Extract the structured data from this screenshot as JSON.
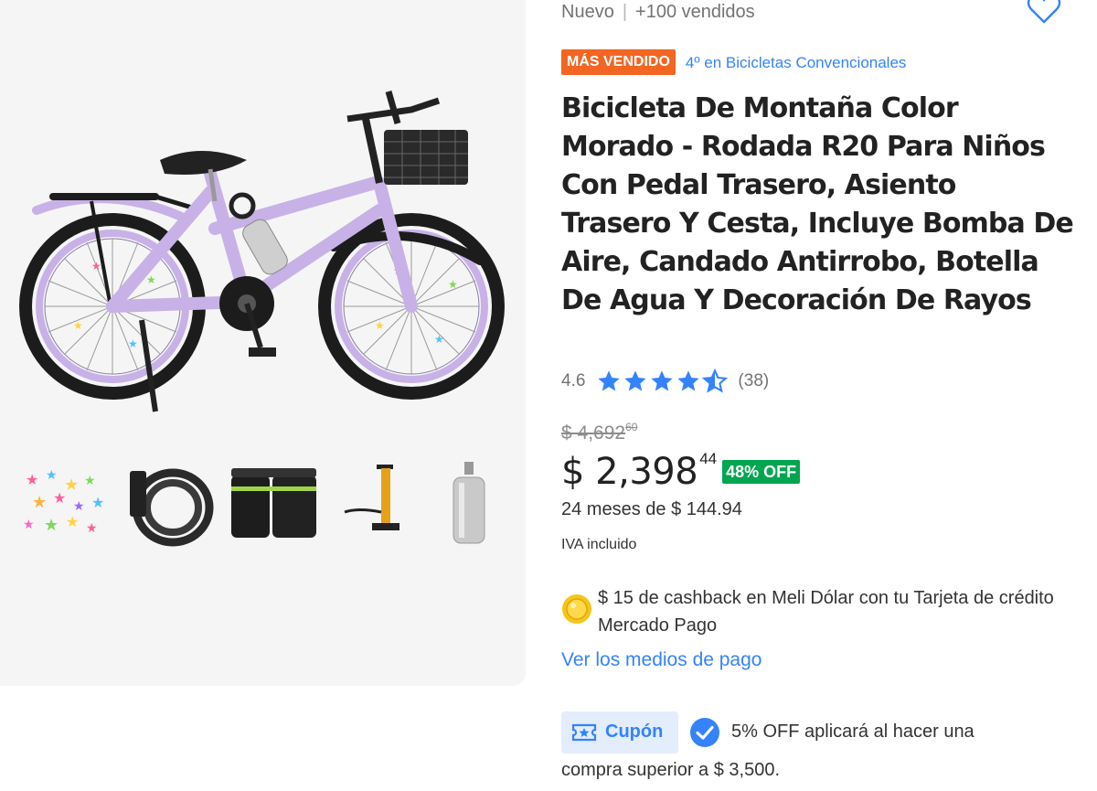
{
  "product": {
    "condition": "Nuevo",
    "separator": "|",
    "sold": "+100 vendidos",
    "badge": "MÁS VENDIDO",
    "category_rank": "4º en Bicicletas Convencionales",
    "title": "Bicicleta De Montaña Color Morado - Rodada R20 Para Niños Con Pedal Trasero, Asiento Trasero Y Cesta, Incluye Bomba De Aire, Candado Antirrobo, Botella De Agua Y Decoración De Rayos",
    "rating": "4.6",
    "rating_value": 4.6,
    "rating_count": "(38)"
  },
  "pricing": {
    "old_price": "$ 4,692",
    "old_price_cents": "60",
    "price": "$ 2,398",
    "price_cents": "44",
    "discount": "48% OFF",
    "installments": "24 meses de $ 144.94",
    "tax_note": "IVA incluido"
  },
  "cashback": {
    "text": "$ 15 de cashback en Meli Dólar con tu Tarjeta de crédito Mercado Pago"
  },
  "payment_link": "Ver los medios de pago",
  "coupon": {
    "label": "Cupón",
    "line1": "5% OFF aplicará al hacer una",
    "line2": "compra superior a $ 3,500."
  },
  "gallery": {
    "main_image": "purple-kids-bicycle",
    "thumbnails": [
      "spoke-stars-decoration",
      "cable-lock",
      "saddle-bag",
      "air-pump",
      "water-bottle"
    ]
  },
  "icons": {
    "favorite": "heart-icon",
    "rating": "star-icon",
    "cashback": "coin-icon",
    "coupon": "ticket-star-icon",
    "coupon_check": "check-circle-icon"
  },
  "colors": {
    "accent_blue": "#3483fa",
    "best_seller_orange": "#f26522",
    "discount_green": "#00a650",
    "bike_purple": "#c8b1e6"
  }
}
